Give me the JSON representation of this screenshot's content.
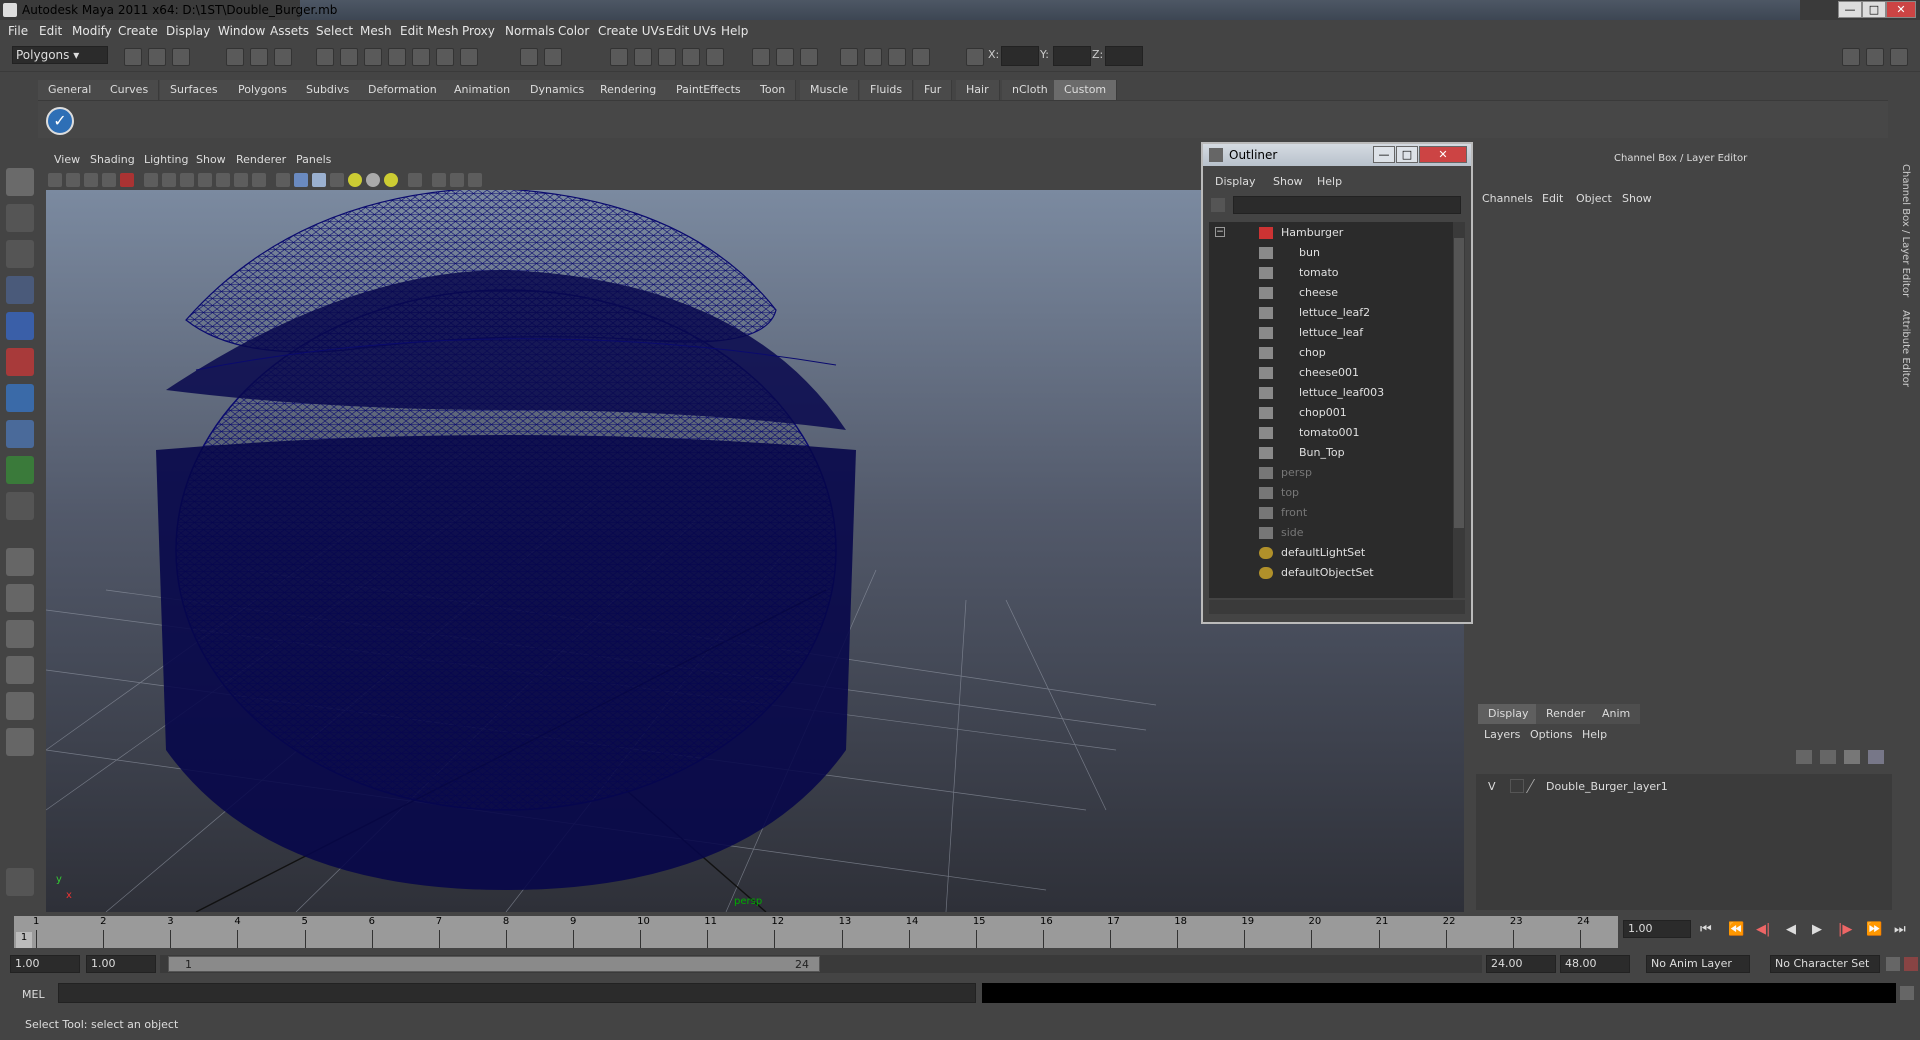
{
  "title": "Autodesk Maya 2011 x64: D:\\1ST\\Double_Burger.mb",
  "window_buttons": [
    "—",
    "□",
    "✕"
  ],
  "menus": [
    "File",
    "Edit",
    "Modify",
    "Create",
    "Display",
    "Window",
    "Assets",
    "Select",
    "Mesh",
    "Edit Mesh",
    "Proxy",
    "Normals",
    "Color",
    "Create UVs",
    "Edit UVs",
    "Help"
  ],
  "toolbar": {
    "mode": "Polygons",
    "x_label": "X:",
    "y_label": "Y:",
    "z_label": "Z:"
  },
  "shelf_tabs": [
    "General",
    "Curves",
    "Surfaces",
    "Polygons",
    "Subdivs",
    "Deformation",
    "Animation",
    "Dynamics",
    "Rendering",
    "PaintEffects",
    "Toon",
    "Muscle",
    "Fluids",
    "Fur",
    "Hair",
    "nCloth",
    "Custom"
  ],
  "shelf_active": "Custom",
  "viewport": {
    "menus": [
      "View",
      "Shading",
      "Lighting",
      "Show",
      "Renderer",
      "Panels"
    ],
    "camera_label": "persp",
    "axis_x": "x",
    "axis_y": "y",
    "wire_color": "#0a0a6e"
  },
  "outliner": {
    "title": "Outliner",
    "menus": [
      "Display",
      "Show",
      "Help"
    ],
    "items": [
      {
        "label": "Hamburger",
        "type": "group",
        "level": 0
      },
      {
        "label": "bun",
        "type": "mesh",
        "level": 1
      },
      {
        "label": "tomato",
        "type": "mesh",
        "level": 1
      },
      {
        "label": "cheese",
        "type": "mesh",
        "level": 1
      },
      {
        "label": "lettuce_leaf2",
        "type": "mesh",
        "level": 1
      },
      {
        "label": "lettuce_leaf",
        "type": "mesh",
        "level": 1
      },
      {
        "label": "chop",
        "type": "mesh",
        "level": 1
      },
      {
        "label": "cheese001",
        "type": "mesh",
        "level": 1
      },
      {
        "label": "lettuce_leaf003",
        "type": "mesh",
        "level": 1
      },
      {
        "label": "chop001",
        "type": "mesh",
        "level": 1
      },
      {
        "label": "tomato001",
        "type": "mesh",
        "level": 1
      },
      {
        "label": "Bun_Top",
        "type": "mesh",
        "level": 1
      },
      {
        "label": "persp",
        "type": "camera",
        "level": 0
      },
      {
        "label": "top",
        "type": "camera",
        "level": 0
      },
      {
        "label": "front",
        "type": "camera",
        "level": 0
      },
      {
        "label": "side",
        "type": "camera",
        "level": 0
      },
      {
        "label": "defaultLightSet",
        "type": "set",
        "level": 0
      },
      {
        "label": "defaultObjectSet",
        "type": "set",
        "level": 0
      }
    ]
  },
  "channel_box": {
    "title": "Channel Box / Layer Editor",
    "menus": [
      "Channels",
      "Edit",
      "Object",
      "Show"
    ],
    "layer_tabs": [
      "Display",
      "Render",
      "Anim"
    ],
    "layer_menus": [
      "Layers",
      "Options",
      "Help"
    ],
    "layer": {
      "visible": "V",
      "name": "Double_Burger_layer1"
    },
    "side_tabs": [
      "Channel Box / Layer Editor",
      "Attribute Editor"
    ]
  },
  "timeline": {
    "ticks": [
      "1",
      "2",
      "3",
      "4",
      "5",
      "6",
      "7",
      "8",
      "9",
      "10",
      "11",
      "12",
      "13",
      "14",
      "15",
      "16",
      "17",
      "18",
      "19",
      "20",
      "21",
      "22",
      "23",
      "24"
    ],
    "current_marker": "1",
    "current_frame": "1.00"
  },
  "range": {
    "start": "1.00",
    "start_inner": "1.00",
    "slider_start": "1",
    "slider_end": "24",
    "end_inner": "24.00",
    "end": "48.00",
    "anim_layer": "No Anim Layer",
    "character_set": "No Character Set"
  },
  "mel": {
    "label": "MEL"
  },
  "help_line": "Select Tool: select an object"
}
